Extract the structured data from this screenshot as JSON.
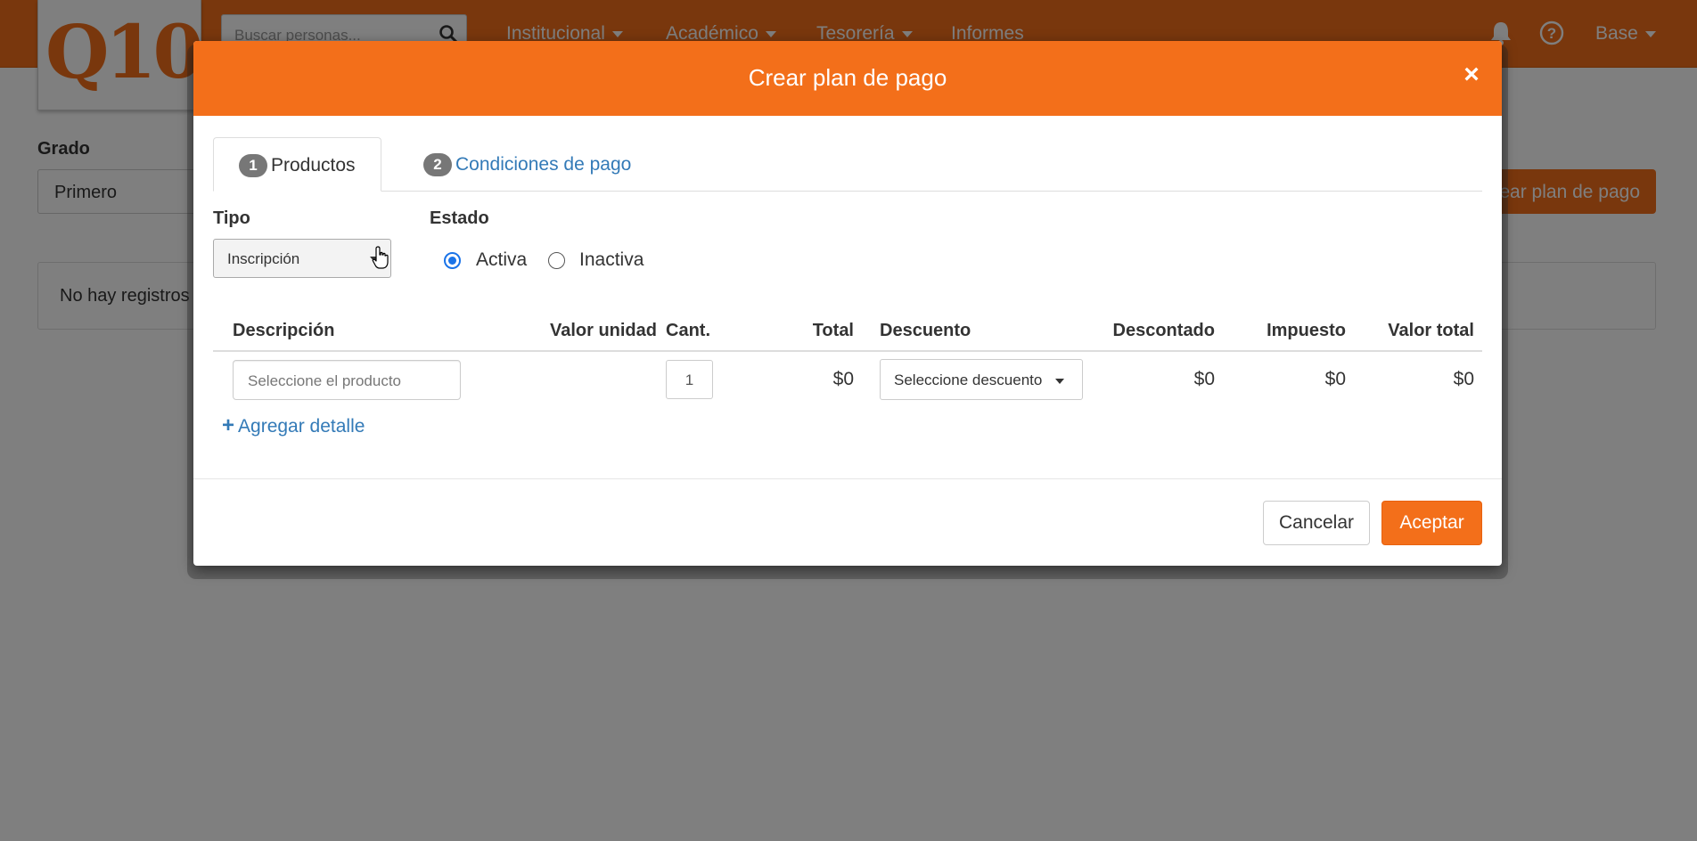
{
  "app": {
    "logo_text": "Q10",
    "search_placeholder": "Buscar personas...",
    "nav": [
      {
        "label": "Institucional"
      },
      {
        "label": "Académico"
      },
      {
        "label": "Tesorería"
      },
      {
        "label": "Informes"
      }
    ],
    "user_menu_label": "Base",
    "grado_label": "Grado",
    "grado_value": "Primero",
    "create_button_label": "Crear plan de pago",
    "empty_message": "No hay registros"
  },
  "modal": {
    "title": "Crear plan de pago",
    "close_label": "×",
    "tabs": [
      {
        "number": "1",
        "label": "Productos",
        "active": true
      },
      {
        "number": "2",
        "label": "Condiciones de pago",
        "active": false
      }
    ],
    "tipo_label": "Tipo",
    "tipo_value": "Inscripción",
    "estado_label": "Estado",
    "estado_options": [
      {
        "label": "Activa",
        "checked": true
      },
      {
        "label": "Inactiva",
        "checked": false
      }
    ],
    "table": {
      "headers": [
        "Descripción",
        "Valor unidad",
        "Cant.",
        "Total",
        "Descuento",
        "Descontado",
        "Impuesto",
        "Valor total"
      ],
      "row": {
        "product_placeholder": "Seleccione el producto",
        "quantity": "1",
        "total": "$0",
        "discount_placeholder": "Seleccione descuento",
        "discounted": "$0",
        "tax": "$0",
        "grand_total": "$0"
      }
    },
    "add_detail_label": "Agregar detalle",
    "cancel_label": "Cancelar",
    "accept_label": "Aceptar"
  },
  "colors": {
    "brand_orange": "#f36f1a",
    "link_blue": "#337ab7",
    "radio_blue": "#1a73e8"
  }
}
